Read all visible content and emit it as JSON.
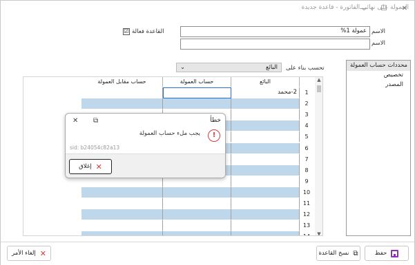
{
  "window": {
    "title": "العمولة على نهائي الفاتورة - قاعدة جديدة",
    "minimize": "—",
    "maximize": "☐",
    "close": "✕"
  },
  "form": {
    "name_label": "الاسم",
    "name_value": "عمولة 1%",
    "latin_name_label": "الاسم اللاتيني",
    "latin_name_value": "",
    "active_rule_label": "القاعدة فعالة",
    "active_rule_checked": "☑",
    "calc_based_on_label": "تحسب بناء على",
    "calc_based_on_value": "البائع"
  },
  "list_panel": {
    "header": "محددات حساب العمولة",
    "items": [
      "تخصيص",
      "المصدر"
    ]
  },
  "grid": {
    "columns": [
      "البائع",
      "حساب العمولة",
      "حساب مقابل العمولة"
    ],
    "rows": [
      {
        "num": "1",
        "seller": "2-محمد"
      },
      {
        "num": "2",
        "seller": ""
      },
      {
        "num": "3",
        "seller": ""
      },
      {
        "num": "4",
        "seller": ""
      },
      {
        "num": "5",
        "seller": ""
      },
      {
        "num": "6",
        "seller": ""
      },
      {
        "num": "7",
        "seller": ""
      },
      {
        "num": "8",
        "seller": ""
      },
      {
        "num": "9",
        "seller": ""
      },
      {
        "num": "10",
        "seller": ""
      },
      {
        "num": "11",
        "seller": ""
      },
      {
        "num": "12",
        "seller": ""
      },
      {
        "num": "13",
        "seller": ""
      },
      {
        "num": "14",
        "seller": ""
      }
    ]
  },
  "dialog": {
    "title": "خطأ",
    "message": "يجب ملء حساب العمولة",
    "sid": "sid: b24054c82a13",
    "close_button": "إغلاق",
    "error_glyph": "!",
    "copy_glyph": "⧉",
    "dismiss_glyph": "✕"
  },
  "bottom": {
    "save": "حفظ",
    "copy_rule": "نسخ القاعدة",
    "cancel": "إلغاء الأمر"
  },
  "colors": {
    "row_alt": "#bfd7ea",
    "selected_border": "#1e6fd9",
    "error_red": "#d83b3b",
    "save_purple": "#8e2fb8"
  }
}
